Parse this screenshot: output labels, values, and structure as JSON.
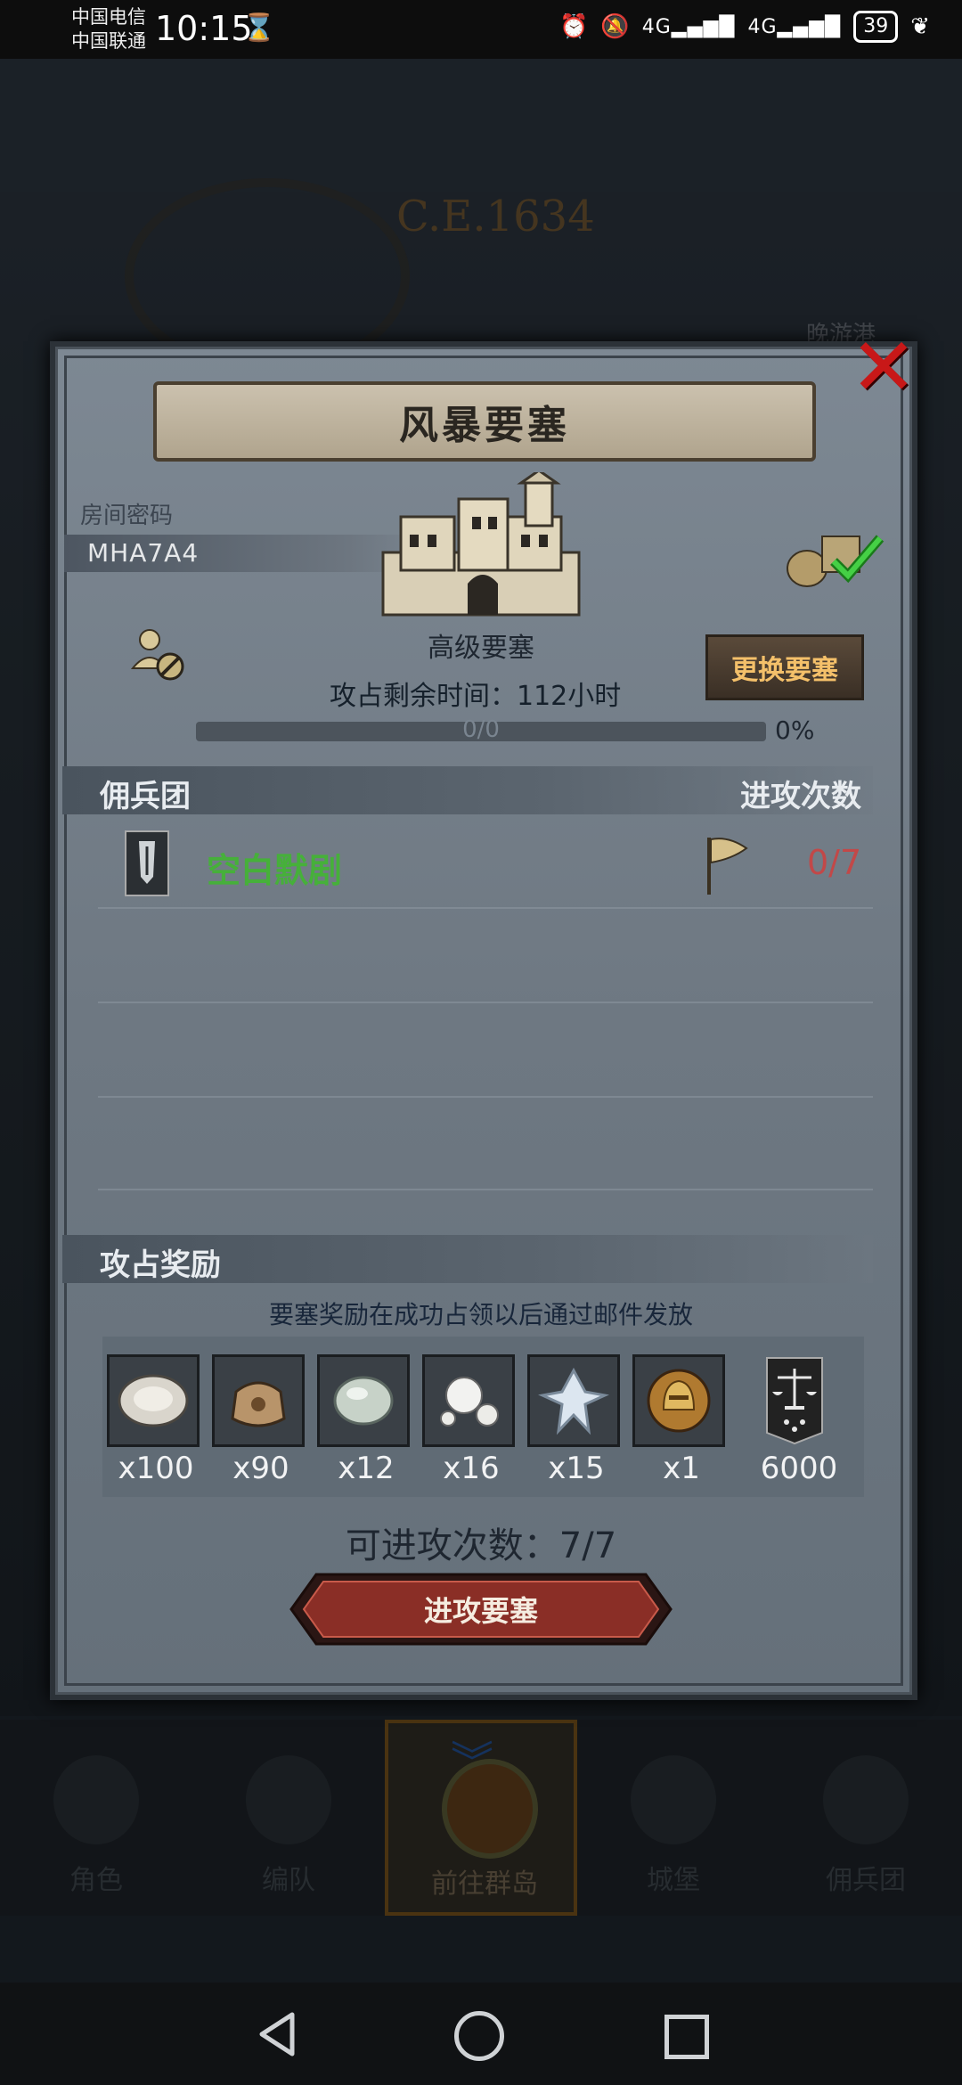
{
  "status_bar": {
    "carrier1": "中国电信",
    "carrier2": "中国联通",
    "time": "10:15",
    "network1": "4G",
    "network2": "4G",
    "battery": "39"
  },
  "background": {
    "era": "C.E.1634",
    "castle_label": "晚游港"
  },
  "bottom_nav": {
    "items": [
      {
        "label": "角色"
      },
      {
        "label": "编队"
      },
      {
        "label": "前往群岛",
        "active": true
      },
      {
        "label": "城堡"
      },
      {
        "label": "佣兵团"
      }
    ]
  },
  "dialog": {
    "title": "风暴要塞",
    "room_label": "房间密码",
    "room_code": "MHA7A4",
    "fortress_name": "高级要塞",
    "remaining_label": "攻占剩余时间：",
    "remaining_value": "112小时",
    "change_button": "更换要塞",
    "progress_text": "0/0",
    "progress_fraction": 0,
    "progress_percent": "0%",
    "merc_header": "佣兵团",
    "attacks_header": "进攻次数",
    "mercenaries": [
      {
        "name": "空白默剧",
        "attacks": "0/7"
      }
    ],
    "reward_header": "攻占奖励",
    "reward_note": "要塞奖励在成功占领以后通过邮件发放",
    "rewards": [
      {
        "icon": "oyster-icon",
        "qty": "x100"
      },
      {
        "icon": "sack-icon",
        "qty": "x90"
      },
      {
        "icon": "stone-icon",
        "qty": "x12"
      },
      {
        "icon": "pearls-icon",
        "qty": "x16"
      },
      {
        "icon": "crystal-icon",
        "qty": "x15"
      },
      {
        "icon": "helmet-medal-icon",
        "qty": "x1"
      },
      {
        "icon": "justice-banner-icon",
        "qty": "6000"
      }
    ],
    "attempts_label": "可进攻次数：7/7",
    "attack_button": "进攻要塞"
  },
  "colors": {
    "merc_name": "#46b03a",
    "attack_count": "#c24848",
    "change_btn_text": "#f4c06a",
    "close_x": "#c81818"
  }
}
